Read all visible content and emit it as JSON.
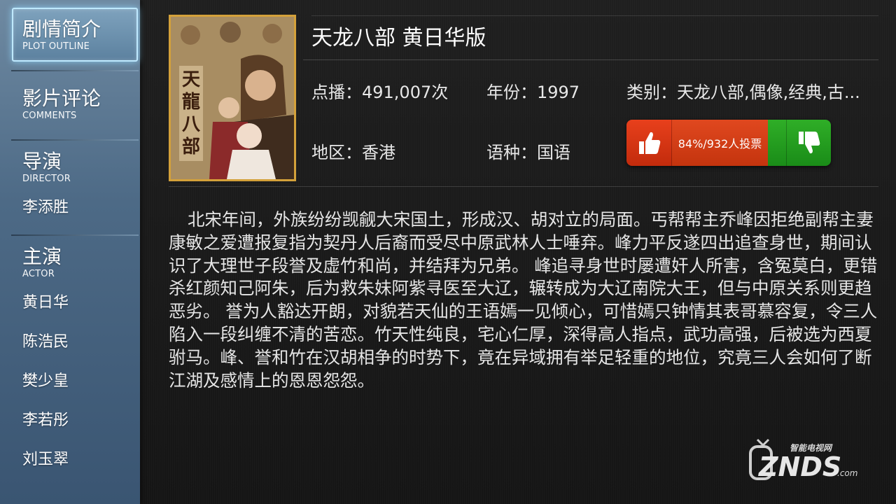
{
  "sidebar": {
    "plot": {
      "zh": "剧情简介",
      "en": "PLOT OUTLINE"
    },
    "comments": {
      "zh": "影片评论",
      "en": "COMMENTS"
    },
    "director": {
      "zh": "导演",
      "en": "DIRECTOR",
      "name": "李添胜"
    },
    "actor": {
      "zh": "主演",
      "en": "ACTOR",
      "names": [
        "黄日华",
        "陈浩民",
        "樊少皇",
        "李若彤",
        "刘玉翠"
      ]
    }
  },
  "movie": {
    "title": "天龙八部 黄日华版",
    "poster_text": "天龍八部",
    "plays": "点播：491,007次",
    "year": "年份：1997",
    "category": "类别：天龙八部,偶像,经典,古...",
    "region": "地区：香港",
    "language": "语种：国语"
  },
  "vote": {
    "text": "84%/932人投票",
    "approval_percent": 84,
    "up_icon": "thumbs-up-icon",
    "down_icon": "thumbs-down-icon",
    "up_color": "#d8391a",
    "down_color": "#24a01f"
  },
  "synopsis": "北宋年间，外族纷纷觊觎大宋国土，形成汉、胡对立的局面。丐帮帮主乔峰因拒绝副帮主妻康敏之爱遭报复指为契丹人后裔而受尽中原武林人士唾弃。峰力平反遂四出追查身世，期间认识了大理世子段誉及虚竹和尚，并结拜为兄弟。 峰追寻身世时屡遭奸人所害，含冤莫白，更错杀红颜知己阿朱，后为救朱妹阿紫寻医至大辽，辗转成为大辽南院大王，但与中原关系则更趋恶劣。 誉为人豁达开朗，对貌若天仙的王语嫣一见倾心，可惜嫣只钟情其表哥慕容复，令三人陷入一段纠缠不清的苦恋。竹天性纯良，宅心仁厚，深得高人指点，武功高强，后被选为西夏驸马。峰、誉和竹在汉胡相争的时势下，竟在异域拥有举足轻重的地位，究竟三人会如何了断江湖及感情上的恩恩怨怨。",
  "watermark": {
    "top": "智能电视网",
    "main": "ZNDS",
    "suffix": ".com"
  }
}
